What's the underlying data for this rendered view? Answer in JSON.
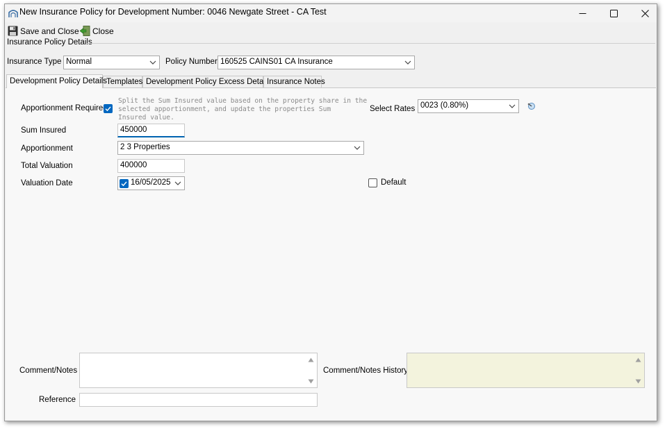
{
  "window": {
    "title": "New Insurance Policy for Development Number: 0046   Newgate Street - CA Test",
    "minimize_glyph": "—",
    "maximize_glyph": "☐",
    "close_glyph": "✕"
  },
  "toolbar": {
    "save_close_label": "Save and Close",
    "close_label": "Close"
  },
  "group": {
    "title": "Insurance Policy Details"
  },
  "header_fields": {
    "insurance_type_label": "Insurance Type",
    "insurance_type_value": "Normal",
    "policy_number_label": "Policy Number",
    "policy_number_value": "160525  CAINS01  CA Insurance"
  },
  "tabs": [
    {
      "label": "Development Policy Details",
      "active": true
    },
    {
      "label": "Templates",
      "active": false
    },
    {
      "label": "Development Policy Excess Details",
      "active": false
    },
    {
      "label": "Insurance Notes",
      "active": false
    }
  ],
  "details": {
    "apportionment_required_label": "Apportionment Required",
    "apportionment_required_checked": true,
    "apportionment_hint": [
      "Split the Sum Insured value based on the property share in the",
      "selected apportionment, and update the properties Sum",
      "Insured value."
    ],
    "select_rates_label": "Select Rates",
    "select_rates_value": "0023 (0.80%)",
    "sum_insured_label": "Sum Insured",
    "sum_insured_value": "450000",
    "apportionment_label": "Apportionment",
    "apportionment_value": "2  3 Properties",
    "total_valuation_label": "Total Valuation",
    "total_valuation_value": "400000",
    "valuation_date_label": "Valuation Date",
    "valuation_date_checked": true,
    "valuation_date_value": "16/05/2025",
    "default_label": "Default",
    "default_checked": false
  },
  "notes": {
    "comment_label": "Comment/Notes",
    "comment_value": "",
    "history_label": "Comment/Notes History",
    "history_value": "",
    "reference_label": "Reference",
    "reference_value": ""
  },
  "colors": {
    "accent": "#0067c0",
    "history_bg": "#f3f3dd",
    "window_bg": "#f0f0f0"
  }
}
